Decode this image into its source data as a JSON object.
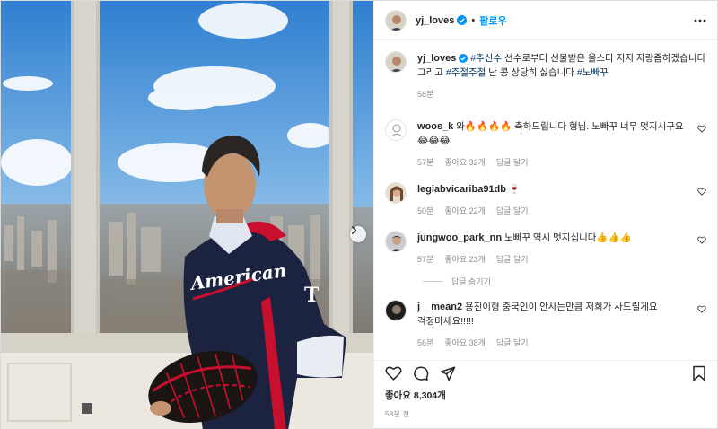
{
  "header": {
    "username": "yj_loves",
    "follow_label": "팔로우",
    "dot": "•",
    "icons": {
      "verified": "verified-badge-icon",
      "more": "more-options-icon"
    }
  },
  "caption": {
    "username": "yj_loves",
    "hashtag_1": "#추신수",
    "text_1": " 선수로부터 선물받은 올스타 저지 자랑좀하겠습니다 그리고 ",
    "hashtag_2": "#주절주절",
    "text_2": " 난 콩 상당히 싫습니다 ",
    "hashtag_3": "#노빠꾸",
    "time": "58분"
  },
  "comments": [
    {
      "username": "woos_k",
      "text": "와🔥🔥🔥🔥 축하드립니다 형님. 노빠꾸 너무 멋지시구요😂😂😂",
      "time": "57분",
      "likes": "좋아요 32개",
      "reply": "답글 달기"
    },
    {
      "username": "legiabvicariba91db",
      "text": "🍷",
      "time": "50분",
      "likes": "좋아요 22개",
      "reply": "답글 달기"
    },
    {
      "username": "jungwoo_park_nn",
      "text": "노빠꾸 역시 멋지십니다👍👍👍",
      "time": "57분",
      "likes": "좋아요 23개",
      "reply": "답글 달기"
    },
    {
      "username": "j__mean2",
      "text": "용진이형 중국인이 안사는만큼 저희가 사드릴게요 걱정마세요!!!!!",
      "time": "56분",
      "likes": "좋아요 38개",
      "reply": "답글 달기"
    }
  ],
  "hide_replies": "답글 숨기기",
  "likes_total": "좋아요 8,304개",
  "posted_time": "58분 전",
  "photo": {
    "jersey_text": "American"
  },
  "colors": {
    "accent": "#0095f6",
    "hashtag": "#00376b",
    "muted": "#8e8e8e",
    "jersey_navy": "#1c2340",
    "jersey_red": "#c8102e"
  }
}
